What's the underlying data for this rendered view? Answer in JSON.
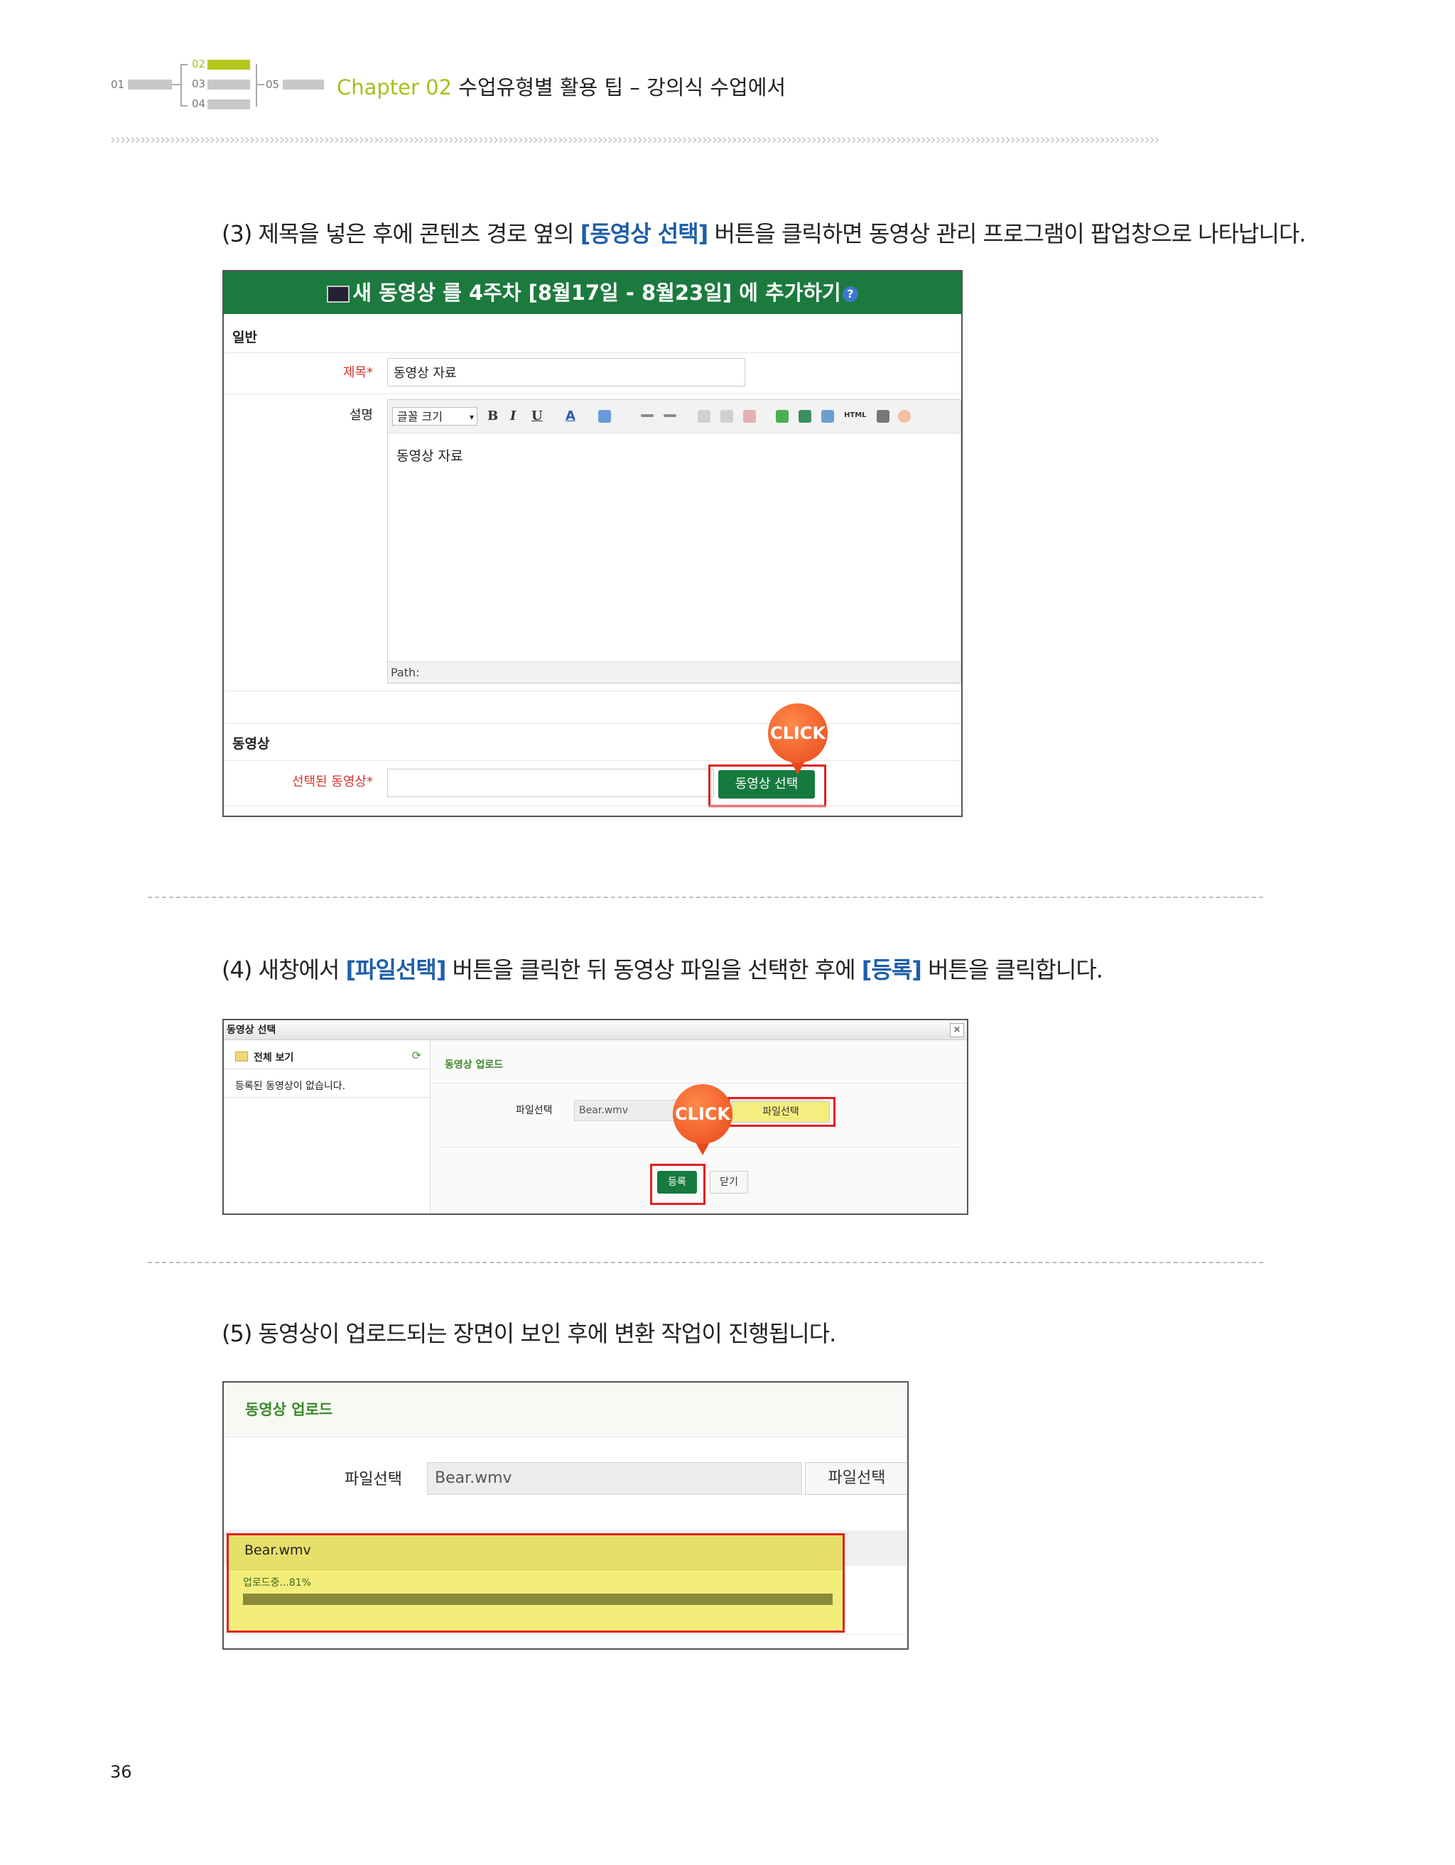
{
  "header": {
    "nav": {
      "n01": "01",
      "n02": "02",
      "n03": "03",
      "n04": "04",
      "n05": "05"
    },
    "chapter_label": "Chapter 02",
    "chapter_title": " 수업유형별 활용 팁 – 강의식 수업에서",
    "chevrons": "›››››››››››››››››››››››››››››››››››››››››››››››››››››››››››››››››››››››››››››››››››››››››››››››››››››››››››››››››››››››››››››››››››››››››››››››››››››››››››››››››››››››››››››››››››››››››››››››››››››››››››››››››››"
  },
  "step3": {
    "prefix": "(3) 제목을 넣은 후에 콘텐츠 경로 옆의 ",
    "highlight": "[동영상 선택]",
    "suffix": " 버튼을 클릭하면 동영상 관리 프로그램이 팝업창으로 나타납니다."
  },
  "shot1": {
    "title": "새 동영상 를 4주차 [8월17일 - 8월23일] 에 추가하기",
    "help": "?",
    "section_general": "일반",
    "label_title": "제목*",
    "title_value": "동영상 자료",
    "label_desc": "설명",
    "font_size_select": "글꼴 크기",
    "tb_bold": "B",
    "tb_italic": "I",
    "tb_underline": "U",
    "tb_color": "A",
    "tb_html": "HTML",
    "editor_content": "동영상 자료",
    "path_label": "Path:",
    "section_video": "동영상",
    "label_selected_video": "선택된 동영상*",
    "select_video_button": "동영상 선택",
    "click_badge": "CLICK"
  },
  "step4": {
    "prefix": "(4) 새창에서 ",
    "highlight1": "[파일선택]",
    "middle": " 버튼을 클릭한 뒤 동영상 파일을 선택한 후에 ",
    "highlight2": "[등록]",
    "suffix": " 버튼을 클릭합니다."
  },
  "shot2": {
    "window_title": "동영상 선택",
    "close": "×",
    "tree_all": "전체 보기",
    "no_videos": "등록된 동영상이 없습니다.",
    "upload_heading": "동영상 업로드",
    "file_select_label": "파일선택",
    "file_value": "Bear.wmv",
    "file_select_button": "파일선택",
    "register_button": "등록",
    "close_button": "닫기",
    "click_badge": "CLICK"
  },
  "step5": {
    "text": "(5) 동영상이 업로드되는 장면이 보인 후에 변환 작업이 진행됩니다."
  },
  "shot3": {
    "upload_heading": "동영상 업로드",
    "file_select_label": "파일선택",
    "file_value": "Bear.wmv",
    "file_select_button": "파일선택",
    "progress_filename": "Bear.wmv",
    "progress_status": "업로드중...81%",
    "progress_fraction": 0.81
  },
  "page_number": "36",
  "colors": {
    "accent_green": "#a8bf1a",
    "title_green": "#1c7a3e",
    "highlight_blue": "#1e5fa8",
    "required_red": "#d0342c",
    "callout_red": "#e02020",
    "progress_fill": "#8a8a3a"
  }
}
